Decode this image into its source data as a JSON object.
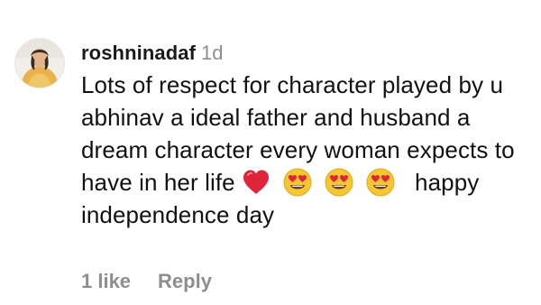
{
  "comment": {
    "username": "roshninadaf",
    "time_ago": "1d",
    "text_main": "Lots of respect for character played by u abhinav a ideal father and husband a dream character every woman expects to have in her life",
    "emojis": [
      "red-heart-emoji",
      "heart-eyes-emoji",
      "heart-eyes-emoji",
      "heart-eyes-emoji"
    ],
    "text_tail": "happy independence day",
    "likes_label": "1 like",
    "reply_label": "Reply"
  },
  "colors": {
    "text": "#111111",
    "muted": "#8e8e8e",
    "heart": "#e0243a",
    "emoji_face": "#f5c634"
  }
}
